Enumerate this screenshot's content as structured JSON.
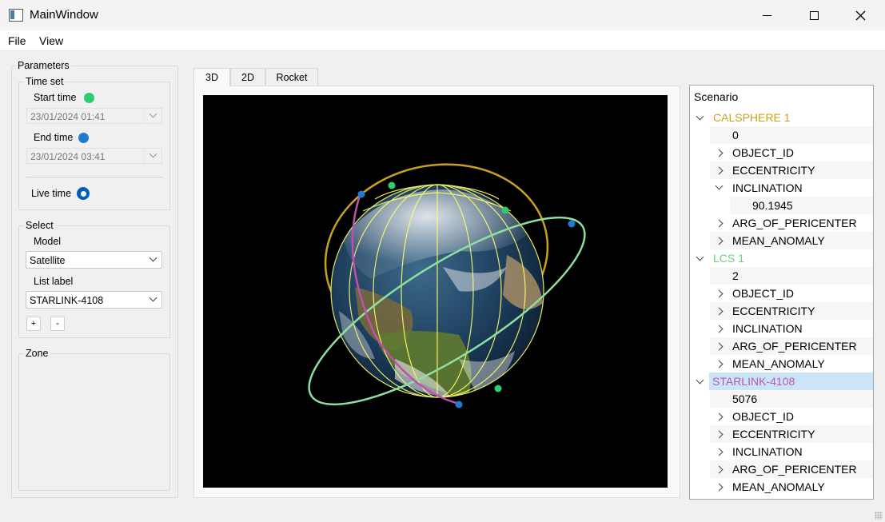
{
  "window": {
    "title": "MainWindow"
  },
  "menu": {
    "items": [
      "File",
      "View"
    ]
  },
  "parameters": {
    "title": "Parameters",
    "time_set": {
      "title": "Time set",
      "start_label": "Start time",
      "start_value": "23/01/2024 01:41",
      "end_label": "End time",
      "end_value": "23/01/2024 03:41",
      "live_label": "Live time"
    },
    "select": {
      "title": "Select",
      "model_label": "Model",
      "model_value": "Satellite",
      "list_label": "List label",
      "list_value": "STARLINK-4108",
      "add_label": "+",
      "remove_label": "-"
    },
    "zone": {
      "title": "Zone"
    }
  },
  "tabs": [
    "3D",
    "2D",
    "Rocket"
  ],
  "scenario": {
    "header": "Scenario",
    "satellites": [
      {
        "name": "CALSPHERE 1",
        "color": "#c9a21a",
        "id": "0",
        "fields": [
          "OBJECT_ID",
          "ECCENTRICITY",
          "INCLINATION",
          "ARG_OF_PERICENTER",
          "MEAN_ANOMALY"
        ],
        "expanded_field": "INCLINATION",
        "expanded_value": "90.1945"
      },
      {
        "name": "LCS 1",
        "color": "#6fce7a",
        "id": "2",
        "fields": [
          "OBJECT_ID",
          "ECCENTRICITY",
          "INCLINATION",
          "ARG_OF_PERICENTER",
          "MEAN_ANOMALY"
        ]
      },
      {
        "name": "STARLINK-4108",
        "color": "#b15cb2",
        "id": "5076",
        "fields": [
          "OBJECT_ID",
          "ECCENTRICITY",
          "INCLINATION",
          "ARG_OF_PERICENTER",
          "MEAN_ANOMALY"
        ]
      }
    ]
  },
  "colors": {
    "start_dot": "#2ecc71",
    "end_dot": "#1f7bd0",
    "calsphere_orbit": "#c9a21a",
    "lcs_orbit": "#8ee0a0",
    "starlink_orbit": "#c050b0",
    "grid": "#ffff66"
  }
}
